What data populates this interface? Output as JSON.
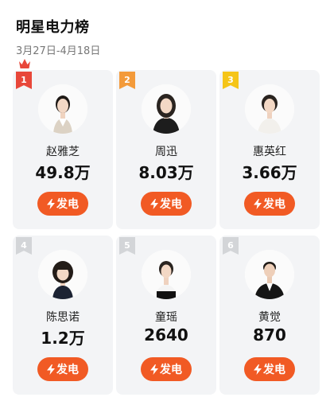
{
  "header": {
    "title": "明星电力榜",
    "date_range": "3月27日-4月18日"
  },
  "button_label": "发电",
  "colors": {
    "accent": "#f15a24",
    "rank_gold_red": "#e8473a",
    "rank_orange": "#f39a3a",
    "rank_yellow": "#f5c518",
    "rank_grey": "#d3d5d8",
    "card_bg": "#f3f4f6"
  },
  "stars": [
    {
      "rank": "1",
      "name": "赵雅芝",
      "value": "49.8万",
      "crown": "crown-icon"
    },
    {
      "rank": "2",
      "name": "周迅",
      "value": "8.03万"
    },
    {
      "rank": "3",
      "name": "惠英红",
      "value": "3.66万"
    },
    {
      "rank": "4",
      "name": "陈思诺",
      "value": "1.2万"
    },
    {
      "rank": "5",
      "name": "童瑶",
      "value": "2640"
    },
    {
      "rank": "6",
      "name": "黄觉",
      "value": "870"
    }
  ]
}
